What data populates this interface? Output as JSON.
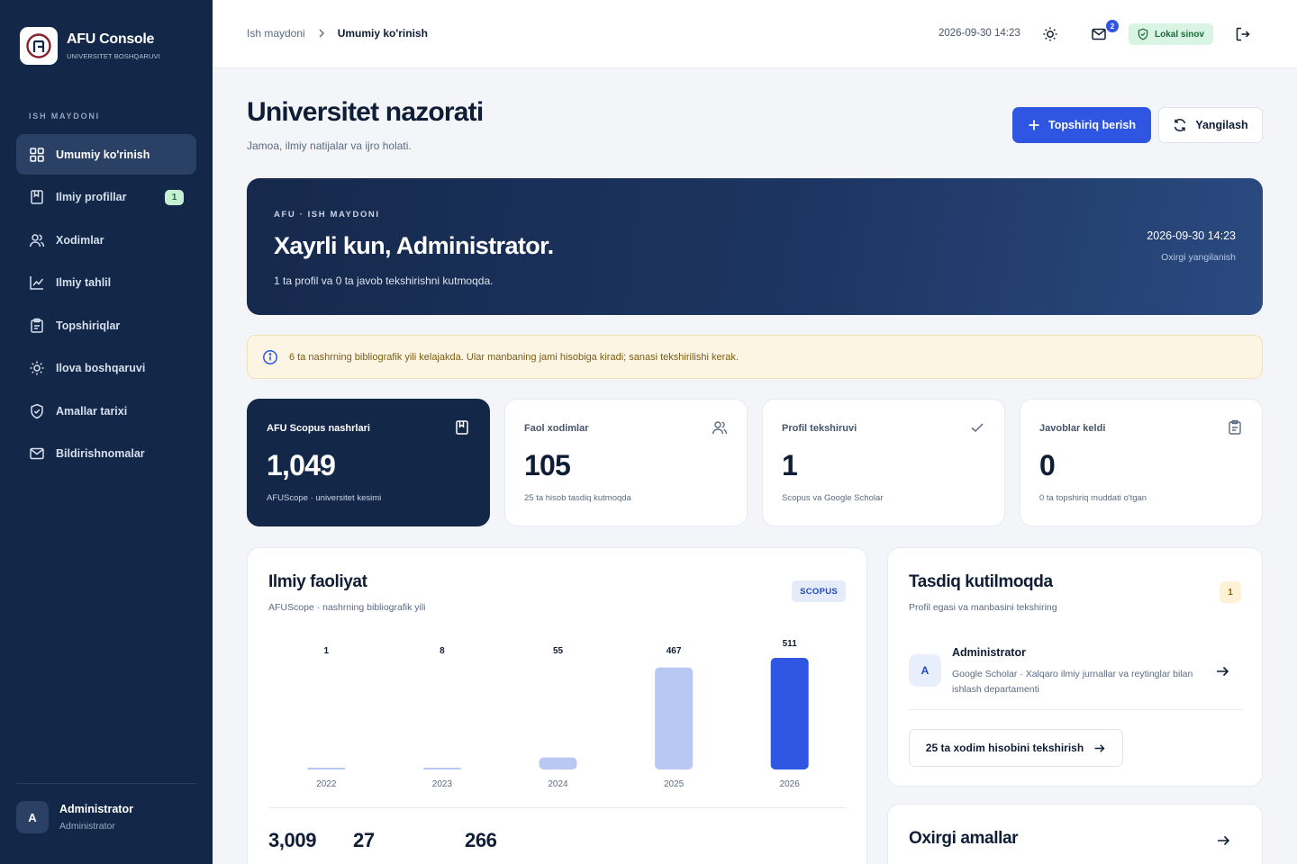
{
  "brand": {
    "title": "AFU Console",
    "subtitle": "UNIVERSITET BOSHQARUVI"
  },
  "sidebar": {
    "section_label": "ISH MAYDONI",
    "items": [
      {
        "label": "Umumiy ko'rinish",
        "icon": "grid-icon",
        "active": true
      },
      {
        "label": "Ilmiy profillar",
        "icon": "bookmark-icon",
        "badge": "1"
      },
      {
        "label": "Xodimlar",
        "icon": "users-icon"
      },
      {
        "label": "Ilmiy tahlil",
        "icon": "chart-line-icon"
      },
      {
        "label": "Topshiriqlar",
        "icon": "clipboard-icon"
      },
      {
        "label": "Ilova boshqaruvi",
        "icon": "sun-gear-icon"
      },
      {
        "label": "Amallar tarixi",
        "icon": "shield-check-icon"
      },
      {
        "label": "Bildirishnomalar",
        "icon": "mail-icon"
      }
    ],
    "user": {
      "initial": "A",
      "name": "Administrator",
      "role": "Administrator"
    }
  },
  "topbar": {
    "breadcrumb": [
      "Ish maydoni",
      "Umumiy ko'rinish"
    ],
    "datetime": "2026-09-30 14:23",
    "mail_count": "2",
    "env_label": "Lokal sinov"
  },
  "header": {
    "title": "Universitet nazorati",
    "subtitle": "Jamoa, ilmiy natijalar va ijro holati.",
    "primary_button": "Topshiriq berish",
    "secondary_button": "Yangilash"
  },
  "hero": {
    "eyebrow": "AFU · ISH MAYDONI",
    "title": "Xayrli kun, Administrator.",
    "subtitle": "1 ta profil va 0 ta javob tekshirishni kutmoqda.",
    "time": "2026-09-30 14:23",
    "time_label": "Oxirgi yangilanish"
  },
  "alert": {
    "text": "6 ta nashrning bibliografik yili kelajakda. Ular manbaning jami hisobiga kiradi; sanasi tekshirilishi kerak."
  },
  "stats": [
    {
      "label": "AFU Scopus nashrlari",
      "value": "1,049",
      "note": "AFUScope · universitet kesimi",
      "icon": "bookmark-icon"
    },
    {
      "label": "Faol xodimlar",
      "value": "105",
      "note": "25 ta hisob tasdiq kutmoqda",
      "icon": "users-icon"
    },
    {
      "label": "Profil tekshiruvi",
      "value": "1",
      "note": "Scopus va Google Scholar",
      "icon": "check-icon"
    },
    {
      "label": "Javoblar keldi",
      "value": "0",
      "note": "0 ta topshiriq muddati o'tgan",
      "icon": "clipboard-icon"
    }
  ],
  "activity": {
    "title": "Ilmiy faoliyat",
    "subtitle": "AFUScope · nashrning bibliografik yili",
    "chip": "SCOPUS",
    "summary": [
      {
        "value": "3,009",
        "label": ""
      },
      {
        "value": "27",
        "label": ""
      },
      {
        "value": "266",
        "label": ""
      }
    ]
  },
  "chart_data": {
    "type": "bar",
    "categories": [
      "2022",
      "2023",
      "2024",
      "2025",
      "2026"
    ],
    "values": [
      1,
      8,
      55,
      467,
      511
    ],
    "ylim": [
      0,
      511
    ],
    "highlight_index": 4,
    "colors": {
      "bar": "#b8c8f3",
      "highlight": "#2e56e2"
    }
  },
  "pending": {
    "title": "Tasdiq kutilmoqda",
    "subtitle": "Profil egasi va manbasini tekshiring",
    "count": "1",
    "item": {
      "initial": "A",
      "name": "Administrator",
      "desc": "Google Scholar · Xalqaro ilmiy jurnallar va reytinglar bilan ishlash departamenti"
    },
    "button": "25 ta xodim hisobini tekshirish"
  },
  "recent": {
    "title": "Oxirgi amallar"
  },
  "colors": {
    "sidebar": "#132849",
    "accent": "#2e56e2",
    "success": "#1d6b3b",
    "warning": "#7a5d14"
  }
}
